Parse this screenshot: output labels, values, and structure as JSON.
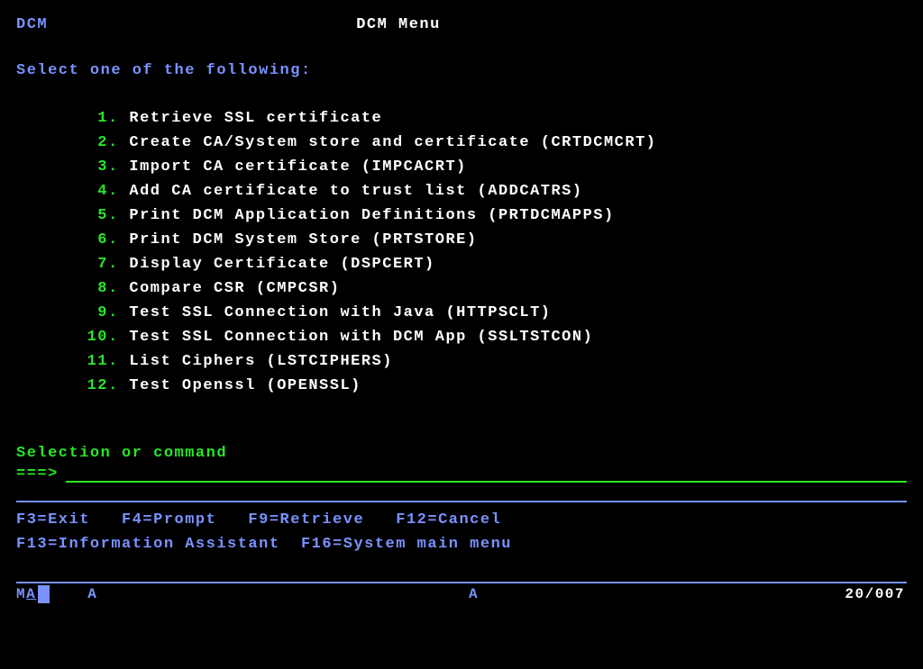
{
  "header": {
    "left": "DCM",
    "title": "DCM Menu"
  },
  "prompt": "Select one of the following:",
  "menu": [
    {
      "n": "1",
      "label": "Retrieve SSL certificate"
    },
    {
      "n": "2",
      "label": "Create CA/System store and certificate (CRTDCMCRT)"
    },
    {
      "n": "3",
      "label": "Import CA certificate (IMPCACRT)"
    },
    {
      "n": "4",
      "label": "Add CA certificate to trust list (ADDCATRS)"
    },
    {
      "n": "5",
      "label": "Print DCM Application Definitions (PRTDCMAPPS)"
    },
    {
      "n": "6",
      "label": "Print DCM System Store (PRTSTORE)"
    },
    {
      "n": "7",
      "label": "Display Certificate (DSPCERT)"
    },
    {
      "n": "8",
      "label": "Compare CSR (CMPCSR)"
    },
    {
      "n": "9",
      "label": "Test SSL Connection with Java (HTTPSCLT)"
    },
    {
      "n": "10",
      "label": "Test SSL Connection with DCM App (SSLTSTCON)"
    },
    {
      "n": "11",
      "label": "List Ciphers (LSTCIPHERS)"
    },
    {
      "n": "12",
      "label": "Test Openssl (OPENSSL)"
    }
  ],
  "selection": {
    "label": "Selection or command",
    "arrow": "===>",
    "value": ""
  },
  "fkeys": {
    "line1": "F3=Exit   F4=Prompt   F9=Retrieve   F12=Cancel",
    "line2": "F13=Information Assistant  F16=System main menu"
  },
  "status": {
    "m": "M",
    "a_under": "A",
    "a1": "A",
    "a2": "A",
    "pos": "20/007"
  }
}
